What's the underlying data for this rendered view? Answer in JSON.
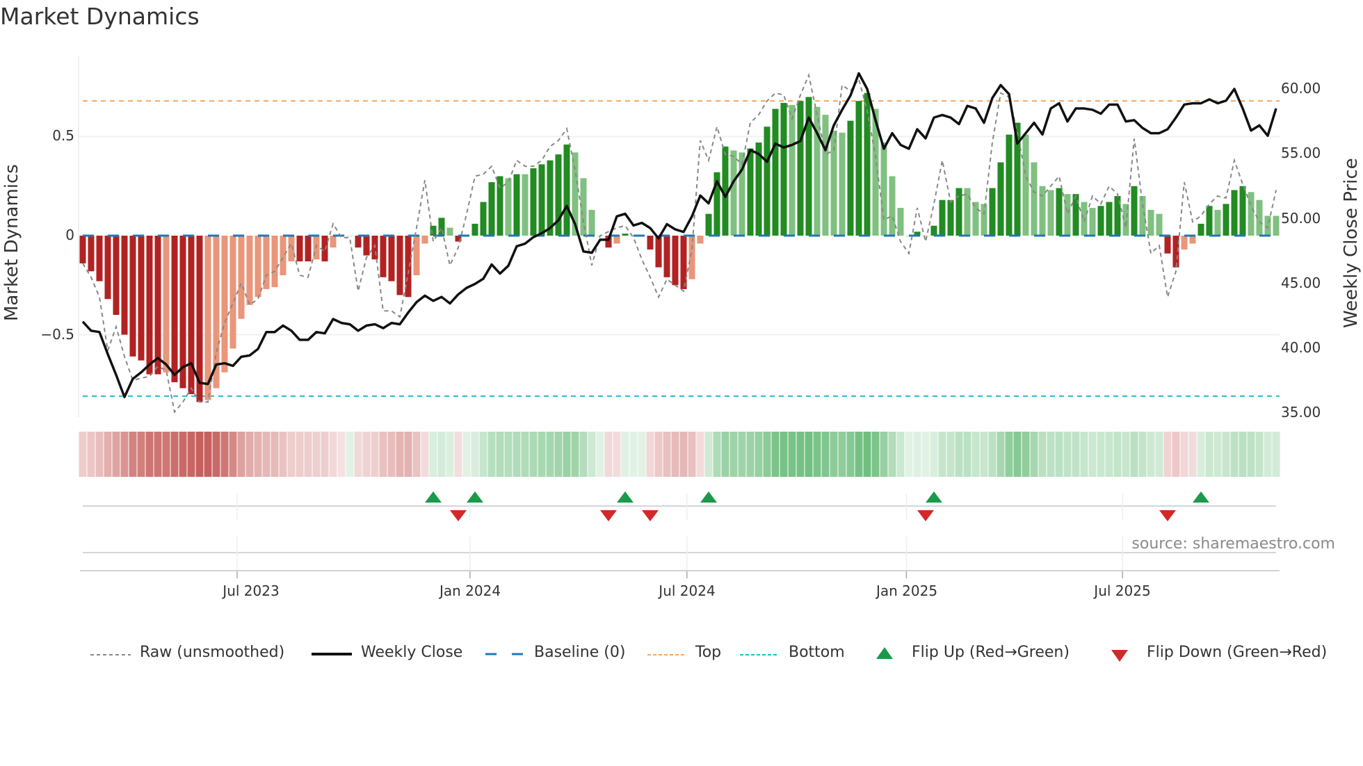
{
  "title": "Market Dynamics",
  "source": "source: sharemaestro.com",
  "chart_data": {
    "type": "bar",
    "title": "Market Dynamics",
    "ylabel": "Market Dynamics",
    "y2label": "Weekly Close Price",
    "ylim": [
      -0.94,
      0.96
    ],
    "y2lim": [
      34.5,
      63.6
    ],
    "yticks": [
      {
        "v": 0.5,
        "label": "0.5"
      },
      {
        "v": 0,
        "label": "0"
      },
      {
        "v": -0.5,
        "label": "−0.5"
      }
    ],
    "y2ticks": [
      {
        "v": 60,
        "label": "60.00"
      },
      {
        "v": 55,
        "label": "55.00"
      },
      {
        "v": 50,
        "label": "50.00"
      },
      {
        "v": 45,
        "label": "45.00"
      },
      {
        "v": 40,
        "label": "40.00"
      },
      {
        "v": 35,
        "label": "35.00"
      }
    ],
    "xticks": [
      {
        "week": 18.5,
        "label": "Jul 2023"
      },
      {
        "week": 46.4,
        "label": "Jan 2024"
      },
      {
        "week": 72.4,
        "label": "Jul 2024"
      },
      {
        "week": 98.7,
        "label": "Jan 2025"
      },
      {
        "week": 124.6,
        "label": "Jul 2025"
      }
    ],
    "x_start": "2023-02-10",
    "x_step_days": 7,
    "reference_lines": {
      "baseline": 0,
      "top": 0.68,
      "bottom": -0.81
    },
    "colors": {
      "strong_neg": "#b22222",
      "weak_neg": "#e9967a",
      "strong_pos": "#228b22",
      "weak_pos": "#80c080",
      "raw": "#888888",
      "close": "#111111",
      "baseline": "#1f77b4",
      "top": "#f4a460",
      "bottom": "#17becf",
      "flip_up": "#1a9a4a",
      "flip_down": "#d62728"
    },
    "dynamics": [
      -0.14,
      -0.18,
      -0.23,
      -0.32,
      -0.4,
      -0.5,
      -0.61,
      -0.63,
      -0.7,
      -0.7,
      -0.69,
      -0.74,
      -0.77,
      -0.8,
      -0.84,
      -0.83,
      -0.77,
      -0.69,
      -0.57,
      -0.42,
      -0.35,
      -0.31,
      -0.27,
      -0.26,
      -0.2,
      -0.13,
      -0.13,
      -0.13,
      -0.12,
      -0.13,
      -0.06,
      -0.005,
      0,
      -0.06,
      -0.1,
      -0.12,
      -0.21,
      -0.23,
      -0.3,
      -0.31,
      -0.2,
      -0.04,
      0.05,
      0.09,
      0.04,
      -0.03,
      0,
      0.06,
      0.17,
      0.27,
      0.3,
      0.29,
      0.31,
      0.31,
      0.34,
      0.36,
      0.38,
      0.41,
      0.46,
      0.42,
      0.29,
      0.13,
      0,
      -0.06,
      -0.04,
      0.01,
      0,
      0,
      -0.07,
      -0.16,
      -0.21,
      -0.25,
      -0.27,
      -0.22,
      -0.04,
      0.11,
      0.32,
      0.45,
      0.43,
      0.42,
      0.44,
      0.47,
      0.55,
      0.64,
      0.67,
      0.66,
      0.68,
      0.7,
      0.65,
      0.61,
      0.53,
      0.52,
      0.58,
      0.68,
      0.72,
      0.64,
      0.47,
      0.3,
      0.14,
      0,
      0.02,
      0,
      0.05,
      0.18,
      0.18,
      0.24,
      0.24,
      0.17,
      0.16,
      0.24,
      0.37,
      0.51,
      0.57,
      0.51,
      0.37,
      0.25,
      0.23,
      0.24,
      0.21,
      0.21,
      0.17,
      0.14,
      0.15,
      0.17,
      0.2,
      0.16,
      0.25,
      0.2,
      0.13,
      0.11,
      -0.09,
      -0.16,
      -0.07,
      -0.04,
      0.06,
      0.15,
      0.13,
      0.16,
      0.23,
      0.25,
      0.22,
      0.18,
      0.1,
      0.1
    ],
    "strengthening": [
      1,
      1,
      1,
      1,
      1,
      1,
      1,
      1,
      1,
      1,
      0,
      1,
      1,
      1,
      1,
      0,
      0,
      0,
      0,
      0,
      0,
      0,
      0,
      0,
      0,
      0,
      1,
      1,
      0,
      1,
      0,
      0,
      0,
      1,
      1,
      1,
      1,
      1,
      1,
      1,
      0,
      0,
      1,
      1,
      0,
      1,
      0,
      1,
      1,
      1,
      1,
      0,
      1,
      0,
      1,
      1,
      1,
      1,
      1,
      0,
      0,
      0,
      0,
      1,
      0,
      1,
      0,
      0,
      1,
      1,
      1,
      1,
      1,
      0,
      0,
      1,
      1,
      1,
      0,
      0,
      1,
      1,
      1,
      1,
      1,
      0,
      1,
      1,
      0,
      0,
      0,
      0,
      1,
      1,
      1,
      0,
      0,
      0,
      0,
      0,
      1,
      0,
      1,
      1,
      1,
      1,
      0,
      0,
      0,
      1,
      1,
      1,
      1,
      0,
      0,
      0,
      0,
      1,
      0,
      1,
      0,
      0,
      1,
      1,
      1,
      0,
      1,
      0,
      0,
      0,
      1,
      1,
      0,
      0,
      1,
      1,
      0,
      1,
      1,
      1,
      0,
      0,
      0,
      0
    ],
    "raw": [
      -0.14,
      -0.21,
      -0.31,
      -0.58,
      -0.46,
      -0.61,
      -0.73,
      -0.72,
      -0.71,
      -0.66,
      -0.68,
      -0.89,
      -0.84,
      -0.77,
      -0.84,
      -0.84,
      -0.59,
      -0.44,
      -0.34,
      -0.24,
      -0.35,
      -0.32,
      -0.2,
      -0.18,
      -0.11,
      -0.04,
      -0.2,
      -0.21,
      -0.05,
      -0.08,
      0.06,
      -0.01,
      -0.01,
      -0.28,
      -0.11,
      -0.05,
      -0.38,
      -0.38,
      -0.41,
      -0.19,
      0.04,
      0.28,
      -0.03,
      0.04,
      -0.15,
      -0.06,
      0.11,
      0.3,
      0.31,
      0.35,
      0.24,
      0.27,
      0.38,
      0.35,
      0.35,
      0.38,
      0.45,
      0.48,
      0.54,
      0.33,
      0.07,
      -0.15,
      0.0,
      0.02,
      0.04,
      0.05,
      -0.01,
      -0.12,
      -0.21,
      -0.31,
      -0.22,
      -0.25,
      -0.28,
      -0.07,
      0.48,
      0.38,
      0.55,
      0.41,
      0.4,
      0.36,
      0.57,
      0.61,
      0.68,
      0.72,
      0.71,
      0.59,
      0.71,
      0.81,
      0.61,
      0.41,
      0.43,
      0.76,
      0.73,
      0.79,
      0.63,
      0.4,
      0.08,
      0.1,
      -0.03,
      -0.09,
      0.14,
      -0.03,
      0.16,
      0.38,
      0.17,
      0.2,
      0.21,
      0.14,
      0.11,
      0.47,
      0.72,
      0.7,
      0.52,
      0.3,
      0.22,
      0.2,
      0.25,
      0.3,
      0.11,
      0.2,
      0.07,
      0.2,
      0.16,
      0.25,
      0.21,
      0.04,
      0.49,
      0.16,
      -0.09,
      -0.05,
      -0.31,
      -0.18,
      0.27,
      0.07,
      0.1,
      0.16,
      0.2,
      0.19,
      0.38,
      0.26,
      0.15,
      0.07,
      0.04,
      0.23
    ],
    "weekly_close": [
      42.1,
      41.4,
      41.3,
      39.6,
      38.0,
      36.3,
      37.7,
      38.2,
      38.8,
      39.3,
      38.8,
      38.0,
      38.6,
      38.9,
      37.4,
      37.3,
      38.8,
      38.9,
      38.7,
      39.4,
      39.5,
      40.0,
      41.3,
      41.3,
      41.8,
      41.4,
      40.7,
      40.7,
      41.3,
      41.2,
      42.3,
      42.0,
      41.9,
      41.4,
      41.8,
      41.9,
      41.6,
      42.0,
      41.9,
      42.8,
      43.6,
      44.1,
      43.7,
      44.0,
      43.5,
      44.2,
      44.7,
      45.0,
      45.4,
      46.5,
      45.8,
      46.4,
      47.9,
      48.1,
      48.6,
      48.9,
      49.3,
      49.9,
      51.0,
      49.6,
      47.5,
      47.4,
      48.4,
      48.4,
      50.2,
      50.4,
      49.5,
      49.7,
      49.3,
      48.5,
      49.6,
      49.2,
      49.0,
      50.2,
      51.8,
      51.2,
      52.9,
      51.7,
      52.9,
      53.8,
      55.3,
      55.0,
      54.4,
      55.8,
      55.5,
      55.7,
      56.0,
      57.8,
      56.6,
      55.3,
      57.2,
      58.4,
      59.5,
      61.2,
      60.0,
      57.6,
      55.4,
      56.6,
      55.7,
      55.4,
      56.9,
      56.2,
      57.8,
      58.0,
      57.8,
      57.3,
      58.7,
      58.5,
      57.4,
      59.3,
      60.3,
      59.6,
      55.8,
      56.6,
      57.4,
      56.5,
      58.5,
      58.9,
      57.5,
      58.5,
      58.5,
      58.4,
      58.1,
      58.8,
      58.8,
      57.5,
      57.6,
      57.0,
      56.6,
      56.6,
      56.9,
      57.8,
      58.8,
      58.9,
      58.9,
      59.2,
      58.9,
      59.1,
      60.0,
      58.5,
      56.8,
      57.2,
      56.4,
      58.5
    ],
    "flip_up_weeks": [
      43,
      48,
      66,
      76,
      103,
      135
    ],
    "flip_down_weeks": [
      46,
      64,
      69,
      102,
      131
    ],
    "legend": {
      "placement": "bottom",
      "raw": "Raw (unsmoothed)",
      "close": "Weekly Close",
      "baseline": "Baseline (0)",
      "top": "Top",
      "bottom": "Bottom",
      "flip_up": "Flip Up (Red→Green)",
      "flip_down": "Flip Down (Green→Red)"
    }
  }
}
